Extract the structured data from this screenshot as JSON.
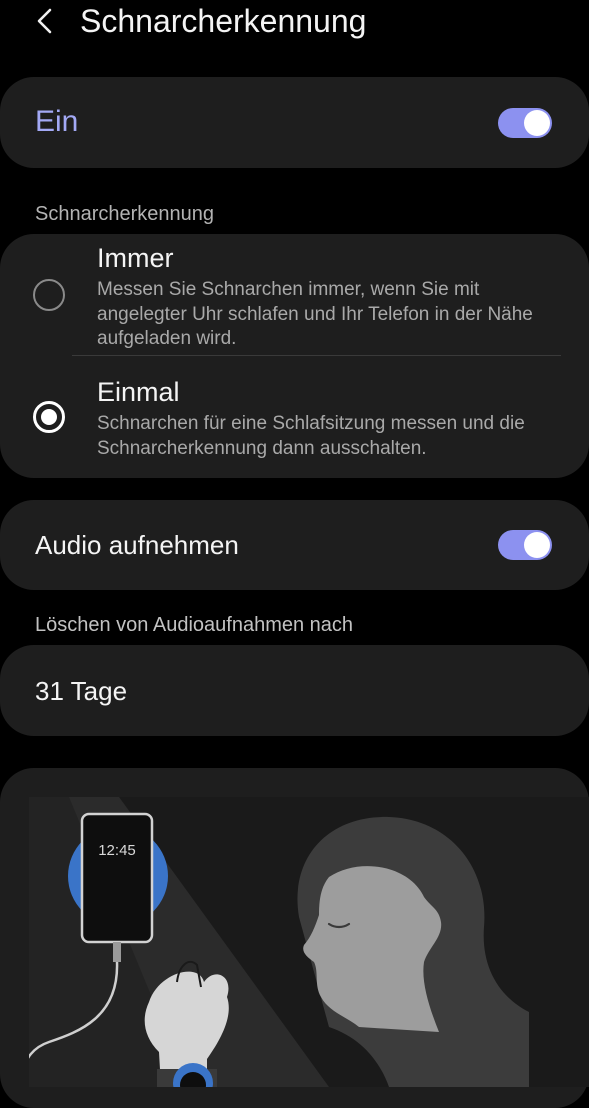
{
  "header": {
    "back_icon": "chevron-left-icon",
    "title": "Schnarcherkennung"
  },
  "master": {
    "label": "Ein",
    "enabled": true
  },
  "mode_section": {
    "label": "Schnarcherkennung",
    "options": [
      {
        "title": "Immer",
        "description": "Messen Sie Schnarchen immer, wenn Sie mit angelegter Uhr schlafen und Ihr Telefon in der Nähe aufgeladen wird.",
        "selected": false
      },
      {
        "title": "Einmal",
        "description": "Schnarchen für eine Schlafsitzung messen und die Schnarcherkennung dann ausschalten.",
        "selected": true
      }
    ]
  },
  "audio": {
    "label": "Audio aufnehmen",
    "enabled": true
  },
  "delete_section": {
    "label": "Löschen von Audioaufnahmen nach",
    "value": "31 Tage"
  },
  "illustration": {
    "phone_time": "12:45"
  },
  "colors": {
    "accent": "#8c91f0",
    "accent_text": "#a3a9f5",
    "card": "#1e1e1e",
    "background": "#000000",
    "charger": "#3a74c8"
  }
}
